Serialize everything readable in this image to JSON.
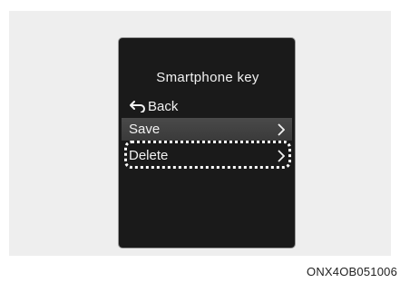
{
  "screen": {
    "title": "Smartphone key",
    "back": {
      "label": "Back",
      "icon": "back-arrow-icon"
    },
    "menu": [
      {
        "label": "Save",
        "selected": true,
        "icon": "chevron-right-icon"
      },
      {
        "label": "Delete",
        "selected": false,
        "highlighted": true,
        "icon": "chevron-right-icon"
      }
    ]
  },
  "figure_code": "ONX4OB051006",
  "colors": {
    "screen_bg": "#1a1a1a",
    "selected_row": "#444444",
    "text": "#f2f2f2",
    "panel_bg": "#eeeeee"
  }
}
